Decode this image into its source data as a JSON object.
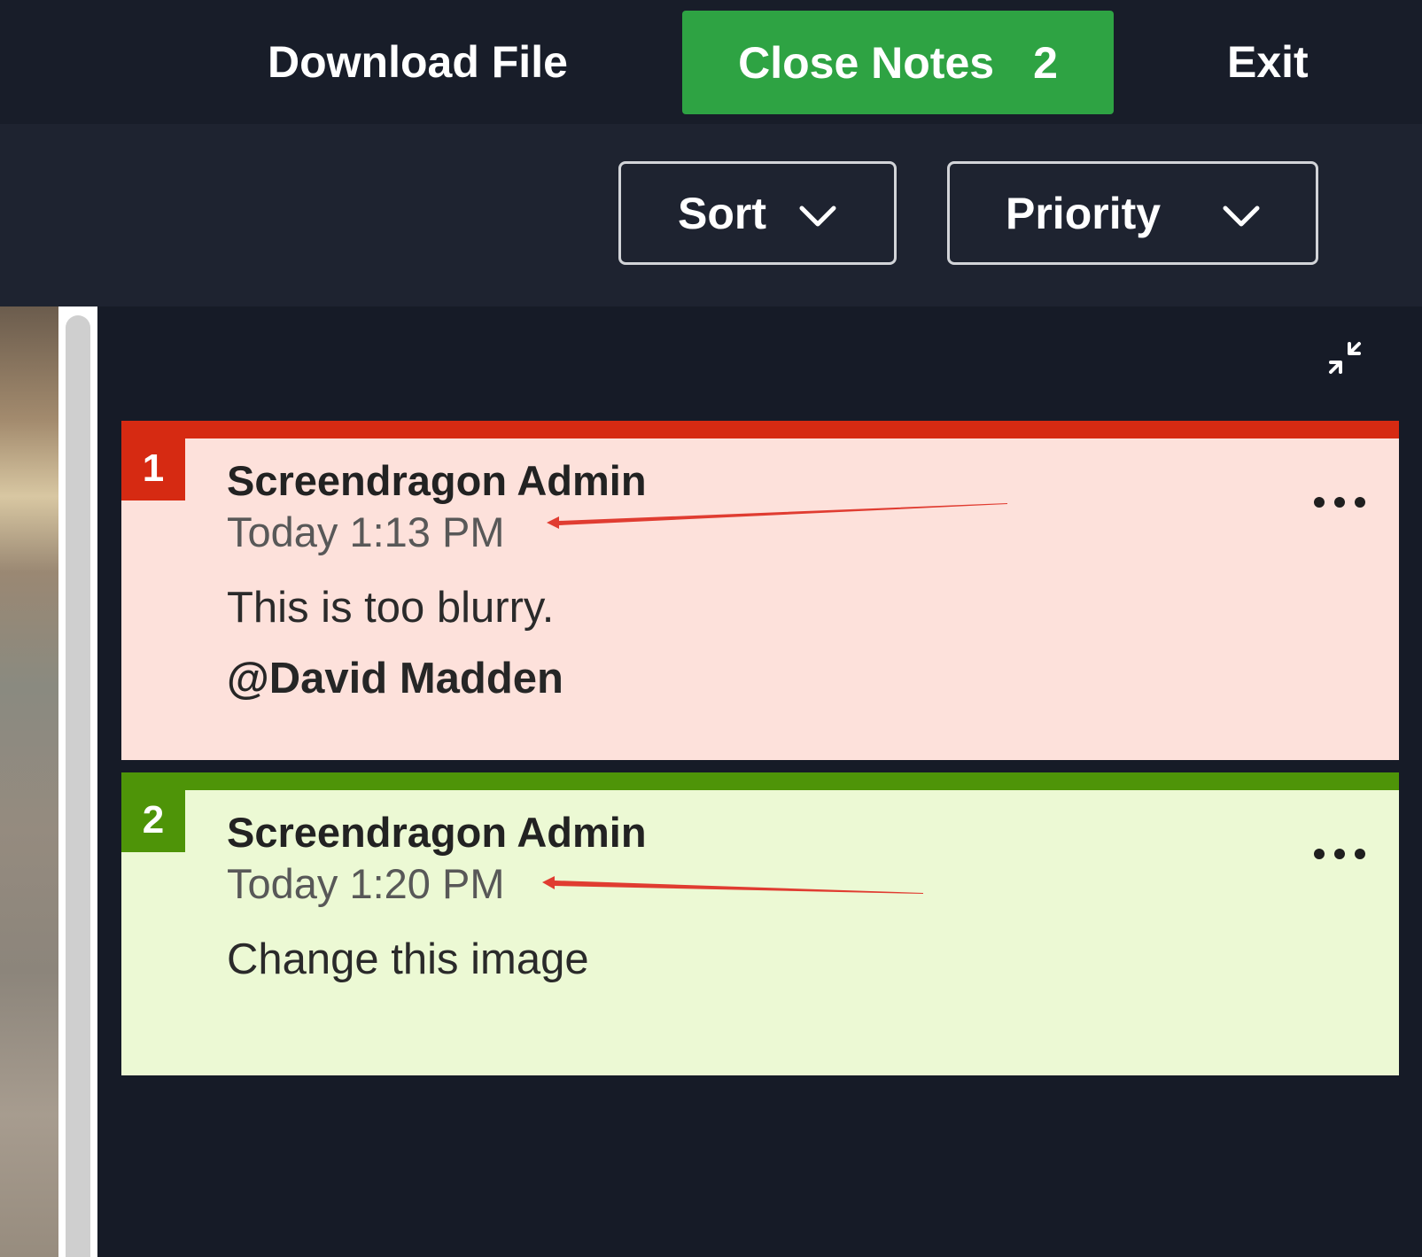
{
  "topbar": {
    "download_label": "Download File",
    "close_notes_label": "Close Notes",
    "close_notes_count": "2",
    "exit_label": "Exit"
  },
  "toolbar": {
    "sort_label": "Sort",
    "priority_label": "Priority"
  },
  "notes": [
    {
      "number": "1",
      "author": "Screendragon Admin",
      "time": "Today 1:13 PM",
      "text": "This is too blurry.",
      "mention": "@David Madden",
      "priority_color": "#d62a12"
    },
    {
      "number": "2",
      "author": "Screendragon Admin",
      "time": "Today 1:20 PM",
      "text": "Change this image",
      "priority_color": "#4e9408"
    }
  ],
  "colors": {
    "accent_green": "#2ea343",
    "annotation_arrow": "#e03c31"
  },
  "icons": {
    "collapse": "collapse-icon",
    "more": "more-options-icon",
    "chevron": "chevron-down-icon"
  }
}
